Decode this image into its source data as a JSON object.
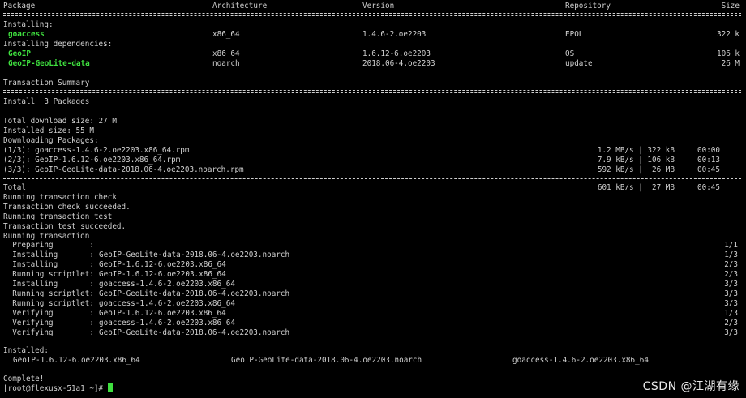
{
  "header": {
    "package": "Package",
    "architecture": "Architecture",
    "version": "Version",
    "repository": "Repository",
    "size": "Size"
  },
  "installing_label": "Installing:",
  "installing_deps_label": "Installing dependencies:",
  "packages": [
    {
      "name": "goaccess",
      "arch": "x86_64",
      "version": "1.4.6-2.oe2203",
      "repo": "EPOL",
      "size": "322 k"
    },
    {
      "name": "GeoIP",
      "arch": "x86_64",
      "version": "1.6.12-6.oe2203",
      "repo": "OS",
      "size": "106 k"
    },
    {
      "name": "GeoIP-GeoLite-data",
      "arch": "noarch",
      "version": "2018.06-4.oe2203",
      "repo": "update",
      "size": "26 M"
    }
  ],
  "transaction_summary": "Transaction Summary",
  "install_line": "Install  3 Packages",
  "total_download": "Total download size: 27 M",
  "installed_size": "Installed size: 55 M",
  "downloading": "Downloading Packages:",
  "downloads": [
    {
      "file": "(1/3): goaccess-1.4.6-2.oe2203.x86_64.rpm",
      "speed": "1.2 MB/s | 322 kB",
      "time": "00:00"
    },
    {
      "file": "(2/3): GeoIP-1.6.12-6.oe2203.x86_64.rpm",
      "speed": "7.9 kB/s | 106 kB",
      "time": "00:13"
    },
    {
      "file": "(3/3): GeoIP-GeoLite-data-2018.06-4.oe2203.noarch.rpm",
      "speed": "592 kB/s |  26 MB",
      "time": "00:45"
    }
  ],
  "total": {
    "label": "Total",
    "speed": "601 kB/s |  27 MB",
    "time": "00:45"
  },
  "status_lines": [
    "Running transaction check",
    "Transaction check succeeded.",
    "Running transaction test",
    "Transaction test succeeded.",
    "Running transaction"
  ],
  "steps": [
    {
      "action": "  Preparing        :",
      "target": "",
      "count": "1/1"
    },
    {
      "action": "  Installing       :",
      "target": "GeoIP-GeoLite-data-2018.06-4.oe2203.noarch",
      "count": "1/3"
    },
    {
      "action": "  Installing       :",
      "target": "GeoIP-1.6.12-6.oe2203.x86_64",
      "count": "2/3"
    },
    {
      "action": "  Running scriptlet:",
      "target": "GeoIP-1.6.12-6.oe2203.x86_64",
      "count": "2/3"
    },
    {
      "action": "  Installing       :",
      "target": "goaccess-1.4.6-2.oe2203.x86_64",
      "count": "3/3"
    },
    {
      "action": "  Running scriptlet:",
      "target": "GeoIP-GeoLite-data-2018.06-4.oe2203.noarch",
      "count": "3/3"
    },
    {
      "action": "  Running scriptlet:",
      "target": "goaccess-1.4.6-2.oe2203.x86_64",
      "count": "3/3"
    },
    {
      "action": "  Verifying        :",
      "target": "GeoIP-1.6.12-6.oe2203.x86_64",
      "count": "1/3"
    },
    {
      "action": "  Verifying        :",
      "target": "goaccess-1.4.6-2.oe2203.x86_64",
      "count": "2/3"
    },
    {
      "action": "  Verifying        :",
      "target": "GeoIP-GeoLite-data-2018.06-4.oe2203.noarch",
      "count": "3/3"
    }
  ],
  "installed_label": "Installed:",
  "installed": [
    "GeoIP-1.6.12-6.oe2203.x86_64",
    "GeoIP-GeoLite-data-2018.06-4.oe2203.noarch",
    "goaccess-1.4.6-2.oe2203.x86_64"
  ],
  "complete": "Complete!",
  "prompt": "[root@flexusx-51a1 ~]# ",
  "watermark": "CSDN @江湖有缘",
  "colors": {
    "background": "#000000",
    "text": "#d0d0d0",
    "package_highlight": "#3fe03f",
    "cursor": "#3fe03f"
  }
}
